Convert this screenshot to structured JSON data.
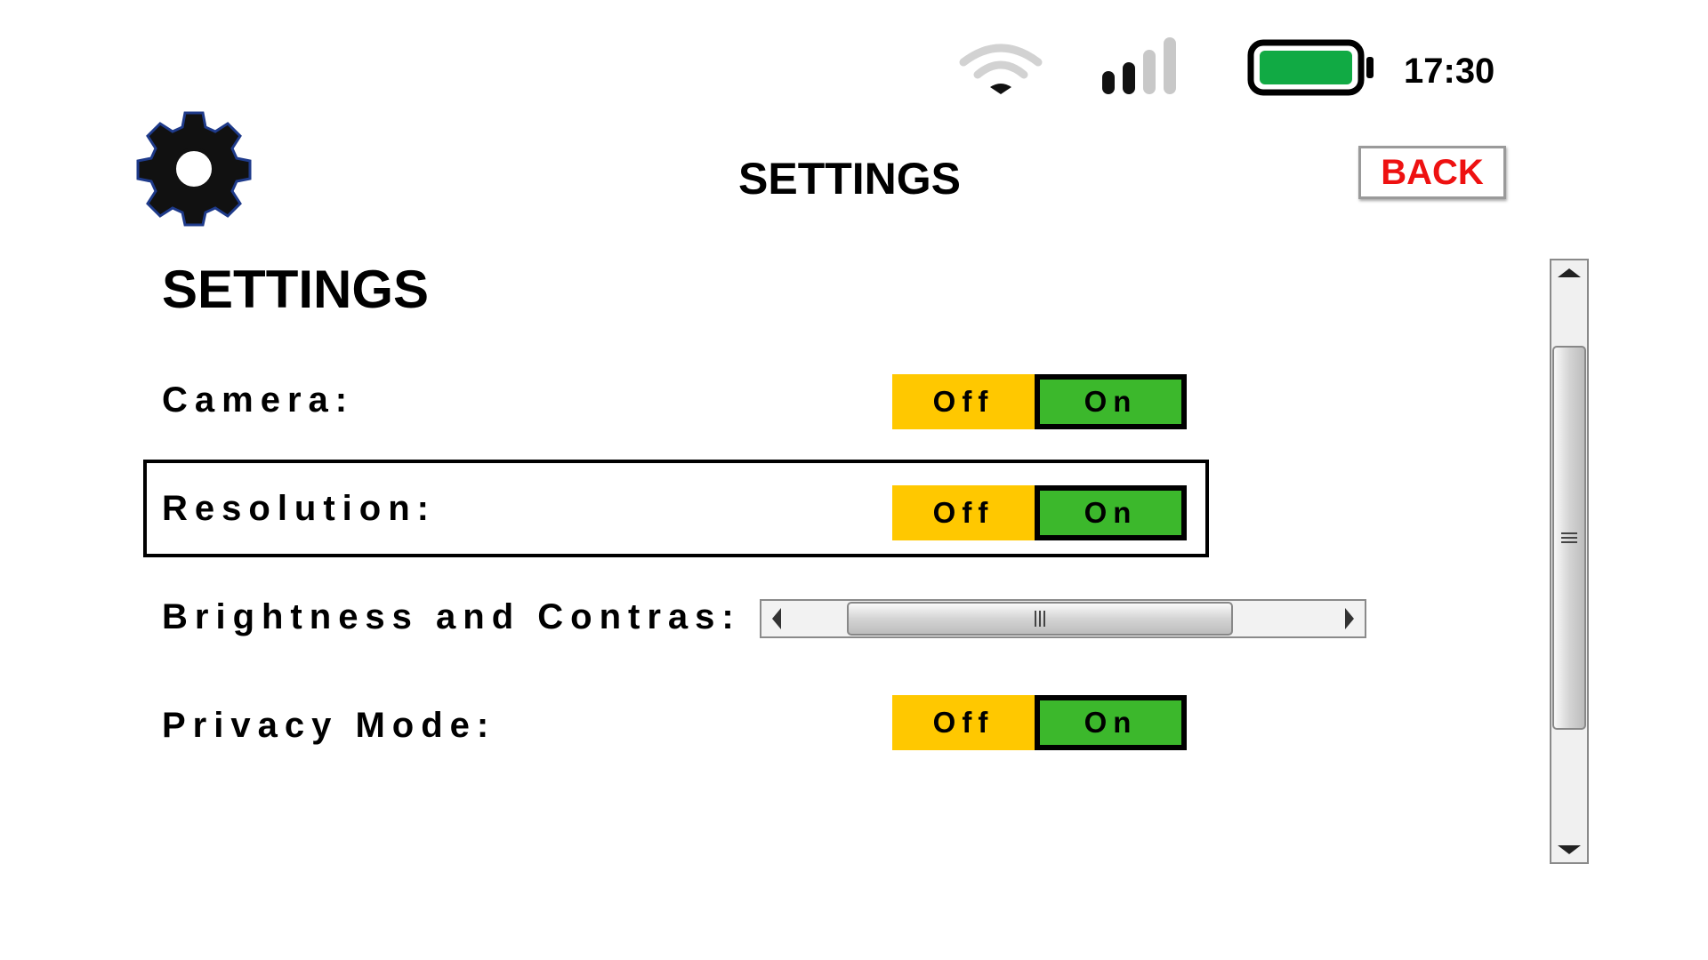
{
  "status_bar": {
    "time": "17:30",
    "wifi_icon": "wifi-icon",
    "signal_icon": "signal-strength-icon",
    "signal_bars_active": 2,
    "signal_bars_total": 4,
    "battery_icon": "battery-icon",
    "battery_level": 1.0,
    "battery_color": "#11aa44"
  },
  "header": {
    "icon": "gear-icon",
    "icon_color": "#111827",
    "title": "SETTINGS",
    "back_label": "BACK",
    "back_color": "#ee1111"
  },
  "section_title": "SETTINGS",
  "settings": [
    {
      "label": "Camera:",
      "off_label": "Off",
      "on_label": "On",
      "selected": "On"
    },
    {
      "label": "Resolution:",
      "off_label": "Off",
      "on_label": "On",
      "selected": "On"
    },
    {
      "label": "Brightness and Contras:",
      "control": "slider"
    },
    {
      "label": "Privacy Mode:",
      "off_label": "Off",
      "on_label": "On",
      "selected": "On"
    }
  ],
  "colors": {
    "off": "#ffc800",
    "on": "#3cb82c"
  }
}
